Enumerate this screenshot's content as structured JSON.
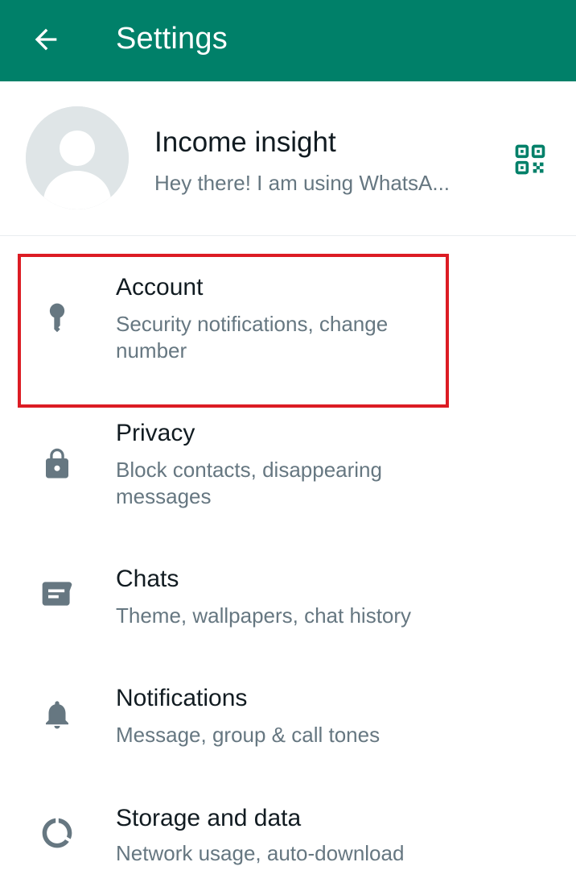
{
  "appbar": {
    "title": "Settings",
    "back_icon": "arrow-left-icon",
    "color": "#008069"
  },
  "profile": {
    "name": "Income insight",
    "status": "Hey there! I am using WhatsA...",
    "avatar_icon": "default-avatar-icon",
    "qr_icon": "qr-code-icon",
    "accent": "#008069"
  },
  "settings": {
    "items": [
      {
        "title": "Account",
        "subtitle": "Security notifications, change number",
        "icon": "key-icon",
        "highlighted": true
      },
      {
        "title": "Privacy",
        "subtitle": "Block contacts, disappearing messages",
        "icon": "lock-icon"
      },
      {
        "title": "Chats",
        "subtitle": "Theme, wallpapers, chat history",
        "icon": "chat-icon"
      },
      {
        "title": "Notifications",
        "subtitle": "Message, group & call tones",
        "icon": "bell-icon"
      },
      {
        "title": "Storage and data",
        "subtitle": "Network usage, auto-download",
        "icon": "storage-circle-icon"
      }
    ]
  },
  "highlight_color": "#dc1c24"
}
